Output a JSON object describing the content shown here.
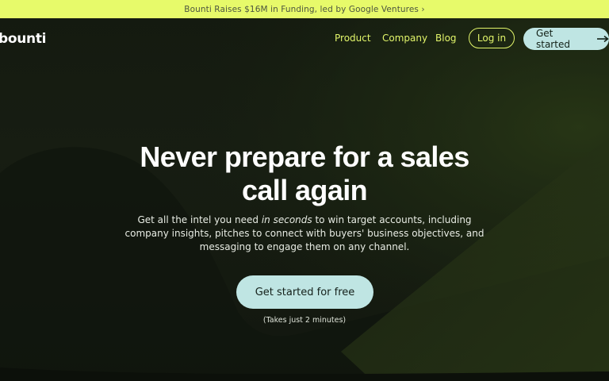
{
  "banner": {
    "text": "Bounti Raises $16M in Funding, led by Google Ventures ›"
  },
  "nav": {
    "logo": "bounti",
    "links": [
      "Product",
      "Company",
      "Blog"
    ],
    "login_label": "Log in",
    "get_started_label": "Get started"
  },
  "hero": {
    "headline_line1": "Never prepare for a sales",
    "headline_line2": "call again",
    "sub_before": "Get all the intel you need ",
    "sub_emphasis": "in seconds",
    "sub_after": " to win target accounts, including company insights, pitches to connect with buyers' business objectives, and messaging to engage them on any channel.",
    "cta_label": "Get started for free",
    "cta_note": "(Takes just 2 minutes)"
  },
  "colors": {
    "banner_bg": "#e7fa6a",
    "accent_lime": "#e2f56a",
    "button_mint": "#bfe5e3",
    "background": "#141a10"
  },
  "icons": {
    "arrow": "arrow-right-icon"
  }
}
